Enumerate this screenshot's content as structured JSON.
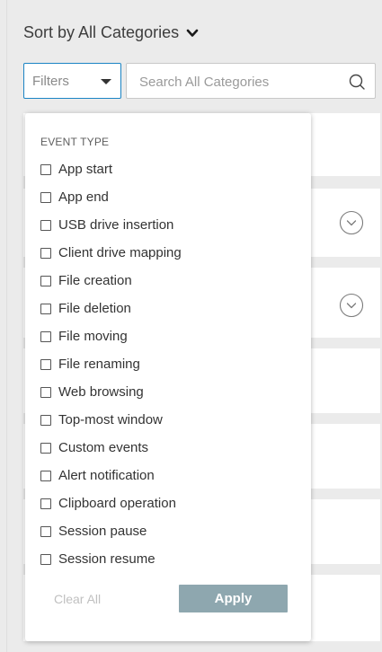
{
  "header": {
    "sort_label": "Sort by All Categories",
    "sort_icon": "chevron-down-icon"
  },
  "filters": {
    "selected": "Filters"
  },
  "search": {
    "placeholder": "Search All Categories",
    "value": "",
    "icon": "search-icon"
  },
  "dropdown": {
    "section_title": "EVENT TYPE",
    "options": [
      {
        "label": "App start",
        "checked": false
      },
      {
        "label": "App end",
        "checked": false
      },
      {
        "label": "USB drive insertion",
        "checked": false
      },
      {
        "label": "Client drive mapping",
        "checked": false
      },
      {
        "label": "File creation",
        "checked": false
      },
      {
        "label": "File deletion",
        "checked": false
      },
      {
        "label": "File moving",
        "checked": false
      },
      {
        "label": "File renaming",
        "checked": false
      },
      {
        "label": "Web browsing",
        "checked": false
      },
      {
        "label": "Top-most window",
        "checked": false
      },
      {
        "label": "Custom events",
        "checked": false
      },
      {
        "label": "Alert notification",
        "checked": false
      },
      {
        "label": "Clipboard operation",
        "checked": false
      },
      {
        "label": "Session pause",
        "checked": false
      },
      {
        "label": "Session resume",
        "checked": false
      }
    ],
    "clear_label": "Clear All",
    "apply_label": "Apply"
  },
  "colors": {
    "accent": "#1b84c4",
    "apply_bg": "#8ea7af",
    "background": "#ebebeb"
  }
}
